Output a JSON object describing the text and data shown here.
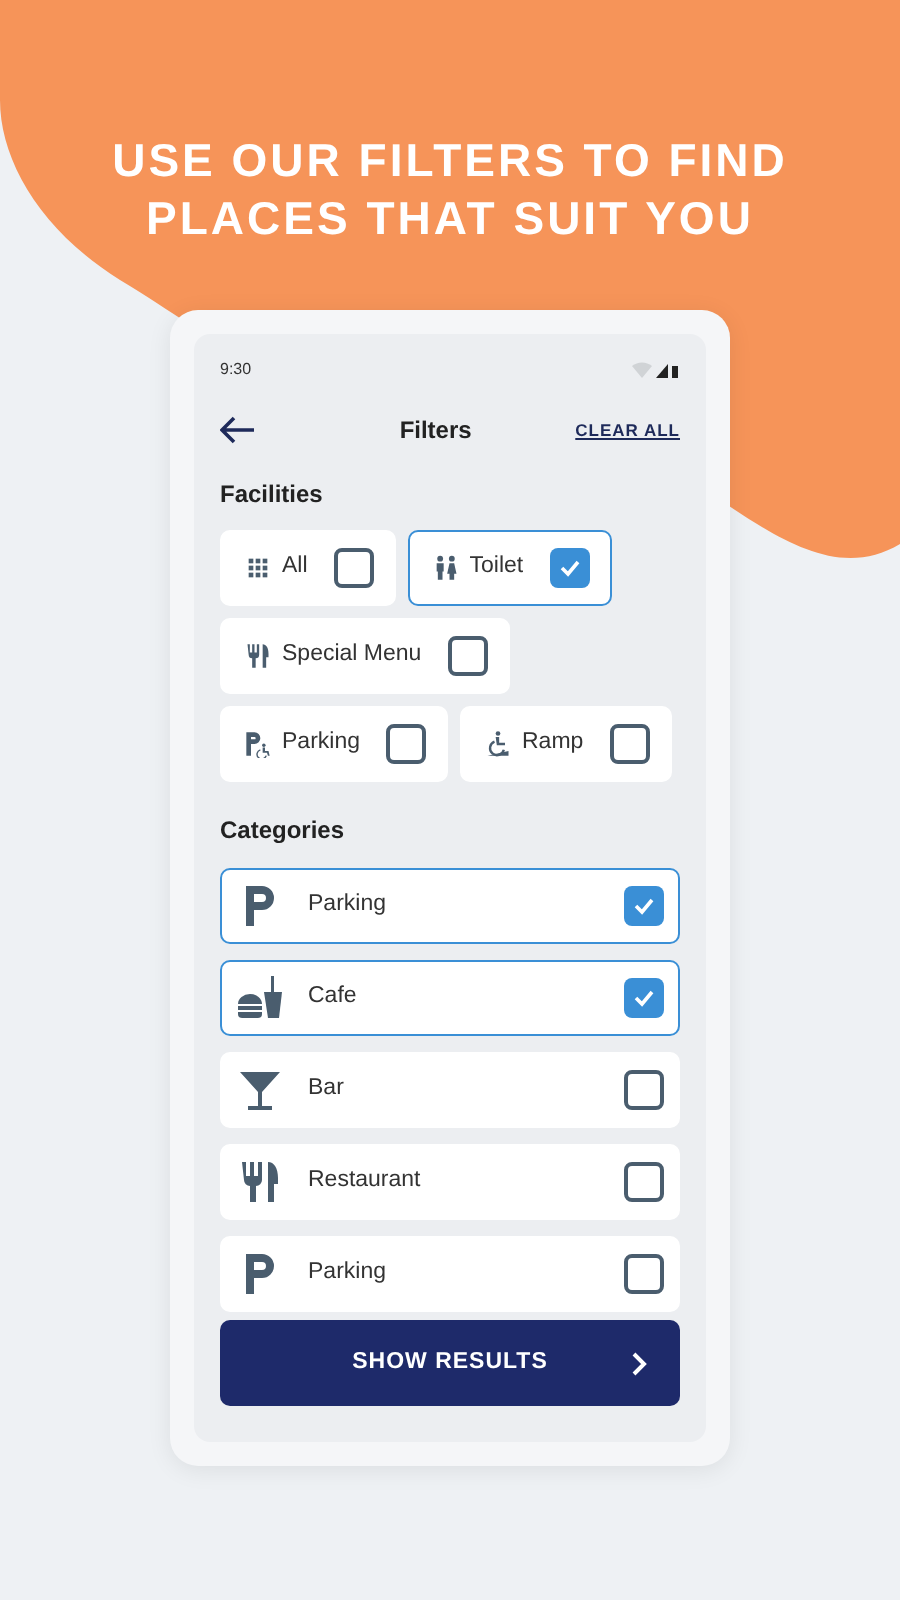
{
  "headline": "USE OUR FILTERS TO FIND PLACES THAT SUIT YOU",
  "status_bar": {
    "time": "9:30"
  },
  "header": {
    "title": "Filters",
    "action": "CLEAR ALL"
  },
  "facilities": {
    "title": "Facilities",
    "rows": [
      [
        {
          "label": "All",
          "kind": "grid",
          "checked": false
        },
        {
          "label": "Toilet",
          "kind": "toilet",
          "checked": true
        }
      ],
      [
        {
          "label": "Special Menu",
          "kind": "cutlery",
          "checked": false
        }
      ],
      [
        {
          "label": "Parking",
          "kind": "parking-accessible",
          "checked": false
        },
        {
          "label": "Ramp",
          "kind": "ramp",
          "checked": false
        }
      ]
    ]
  },
  "categories": {
    "title": "Categories",
    "items": [
      {
        "label": "Parking",
        "kind": "parking",
        "checked": true
      },
      {
        "label": "Cafe",
        "kind": "cafe",
        "checked": true
      },
      {
        "label": "Bar",
        "kind": "bar",
        "checked": false
      },
      {
        "label": "Restaurant",
        "kind": "cutlery",
        "checked": false
      },
      {
        "label": "Parking",
        "kind": "parking",
        "checked": false
      }
    ]
  },
  "show_results": {
    "label": "SHOW RESULTS"
  }
}
